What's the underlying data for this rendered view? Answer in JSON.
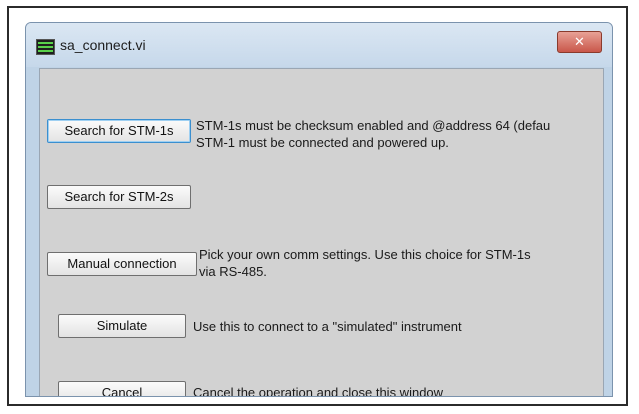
{
  "window": {
    "title": "sa_connect.vi",
    "icon": "labview-vi-icon",
    "close_glyph": "✕"
  },
  "options": [
    {
      "button_label": "Search for STM-1s",
      "description": [
        "STM-1s must be checksum enabled and @address 64 (defau",
        "STM-1 must be connected and powered up."
      ]
    },
    {
      "button_label": "Search for STM-2s",
      "description": []
    },
    {
      "button_label": "Manual connection",
      "description": [
        "Pick your own comm settings. Use this choice for STM-1s",
        "via RS-485."
      ]
    },
    {
      "button_label": "Simulate",
      "description": [
        "Use this to connect to a \"simulated\" instrument"
      ]
    },
    {
      "button_label": "Cancel",
      "description": [
        "Cancel the operation and close this window"
      ]
    }
  ]
}
